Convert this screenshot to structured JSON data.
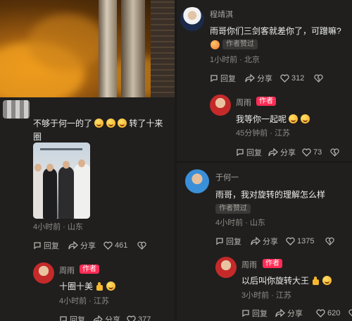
{
  "left": {
    "comment": {
      "text_part1": "不够于何一的了",
      "text_part2": "转了十来",
      "text_line2": "圈",
      "meta": "4小时前 · 山东",
      "reply_label": "回复",
      "share_label": "分享",
      "like_count": "461"
    },
    "reply": {
      "username": "周雨",
      "author_badge": "作者",
      "text": "十圈十美",
      "meta": "4小时前 · 江苏",
      "reply_label": "回复",
      "share_label": "分享",
      "like_count": "377"
    }
  },
  "right_top": {
    "comment": {
      "username": "程靖淇",
      "text": "雨哥你们三剑客就差你了，可蹭嘛?",
      "fan_badge": "作者赞过",
      "meta": "1小时前 · 北京",
      "reply_label": "回复",
      "share_label": "分享",
      "like_count": "312"
    },
    "reply": {
      "username": "周雨",
      "author_badge": "作者",
      "text": "我等你一起呢",
      "meta": "45分钟前 · 江苏",
      "reply_label": "回复",
      "share_label": "分享",
      "like_count": "73"
    }
  },
  "right_bottom": {
    "comment": {
      "username": "于何一",
      "text": "雨哥，我对旋转的理解怎么样",
      "fan_badge": "作者赞过",
      "meta": "4小时前 · 山东",
      "reply_label": "回复",
      "share_label": "分享",
      "like_count": "1375"
    },
    "reply": {
      "username": "周雨",
      "author_badge": "作者",
      "text": "以后叫你旋转大王",
      "meta": "3小时前 · 江苏",
      "reply_label": "回复",
      "share_label": "分享",
      "like_count": "620"
    }
  },
  "icons": [
    "reply-icon",
    "share-icon",
    "like-icon",
    "dislike-icon",
    "laugh-emoji",
    "thumbs-up-emoji"
  ],
  "colors": {
    "author_badge": "#fe2c55",
    "background": "#201f1e",
    "meta_text": "#8e8a85"
  }
}
